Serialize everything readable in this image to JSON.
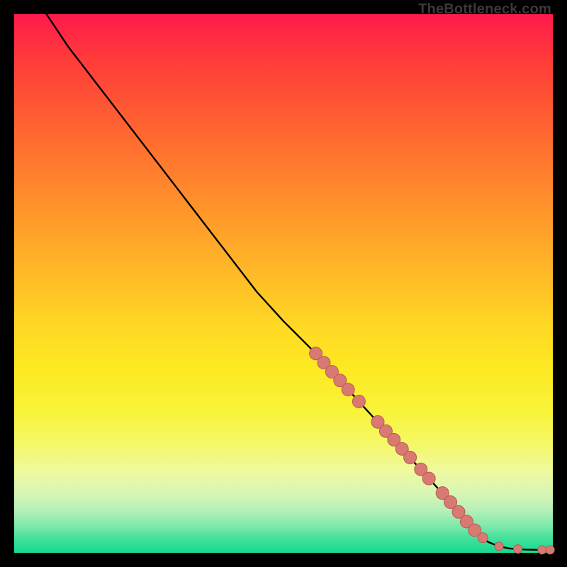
{
  "watermark": "TheBottleneck.com",
  "colors": {
    "dot_fill": "#d87a72",
    "dot_stroke": "#b85a55",
    "line": "#000000"
  },
  "chart_data": {
    "type": "line",
    "title": "",
    "xlabel": "",
    "ylabel": "",
    "xlim": [
      0,
      100
    ],
    "ylim": [
      0,
      100
    ],
    "grid": false,
    "legend": false,
    "series": [
      {
        "name": "curve",
        "style": "line",
        "x": [
          6,
          10,
          15,
          20,
          25,
          30,
          35,
          40,
          45,
          50,
          52,
          55,
          60,
          65,
          70,
          75,
          80,
          82,
          84,
          86.5,
          88,
          90,
          92,
          95,
          97.5,
          99.5
        ],
        "y": [
          100,
          94,
          87.5,
          81,
          74.5,
          68,
          61.5,
          55,
          48.5,
          43,
          41,
          38,
          32.5,
          27,
          21.5,
          16,
          10.5,
          8,
          5.8,
          3.2,
          2.0,
          1.2,
          0.8,
          0.6,
          0.55,
          0.55
        ]
      },
      {
        "name": "markers",
        "style": "scatter",
        "points": [
          {
            "x": 56.0,
            "y": 37.0,
            "r": 9
          },
          {
            "x": 57.5,
            "y": 35.3,
            "r": 9
          },
          {
            "x": 59.0,
            "y": 33.6,
            "r": 9
          },
          {
            "x": 60.5,
            "y": 32.0,
            "r": 9
          },
          {
            "x": 62.0,
            "y": 30.3,
            "r": 9
          },
          {
            "x": 64.0,
            "y": 28.1,
            "r": 9
          },
          {
            "x": 67.5,
            "y": 24.3,
            "r": 9
          },
          {
            "x": 69.0,
            "y": 22.6,
            "r": 9
          },
          {
            "x": 70.5,
            "y": 21.0,
            "r": 9
          },
          {
            "x": 72.0,
            "y": 19.3,
            "r": 9
          },
          {
            "x": 73.5,
            "y": 17.7,
            "r": 9
          },
          {
            "x": 75.5,
            "y": 15.5,
            "r": 9
          },
          {
            "x": 77.0,
            "y": 13.8,
            "r": 9
          },
          {
            "x": 79.5,
            "y": 11.1,
            "r": 9
          },
          {
            "x": 81.0,
            "y": 9.4,
            "r": 9
          },
          {
            "x": 82.5,
            "y": 7.6,
            "r": 9
          },
          {
            "x": 84.0,
            "y": 5.8,
            "r": 9
          },
          {
            "x": 85.5,
            "y": 4.2,
            "r": 9
          },
          {
            "x": 87.0,
            "y": 2.8,
            "r": 7
          },
          {
            "x": 90.0,
            "y": 1.2,
            "r": 6
          },
          {
            "x": 93.5,
            "y": 0.7,
            "r": 6
          },
          {
            "x": 98.0,
            "y": 0.55,
            "r": 6
          },
          {
            "x": 99.5,
            "y": 0.55,
            "r": 6
          }
        ]
      }
    ]
  }
}
